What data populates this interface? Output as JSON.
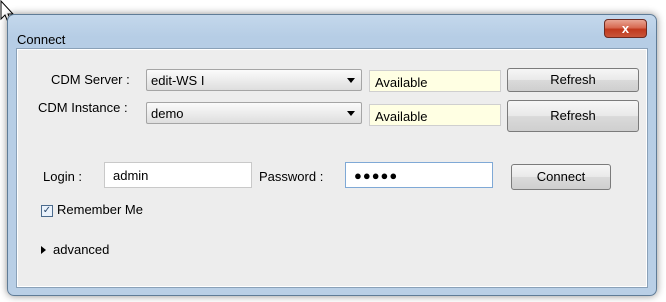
{
  "window": {
    "title": "Connect",
    "close_label": "x"
  },
  "server_row": {
    "label": "CDM Server :",
    "selected": "edit-WS I",
    "status": "Available",
    "refresh_label": "Refresh"
  },
  "instance_row": {
    "label": "CDM Instance :",
    "selected": "demo",
    "status": "Available",
    "refresh_label": "Refresh"
  },
  "login": {
    "login_label": "Login :",
    "login_value": "admin",
    "password_label": "Password :",
    "password_mask": "●●●●●",
    "connect_label": "Connect"
  },
  "remember": {
    "label": "Remember Me",
    "checked": true
  },
  "advanced": {
    "label": "advanced"
  },
  "colors": {
    "status_bg": "#ffffe3",
    "close_red": "#c9553a",
    "frame_blue": "#b9cfe6"
  }
}
